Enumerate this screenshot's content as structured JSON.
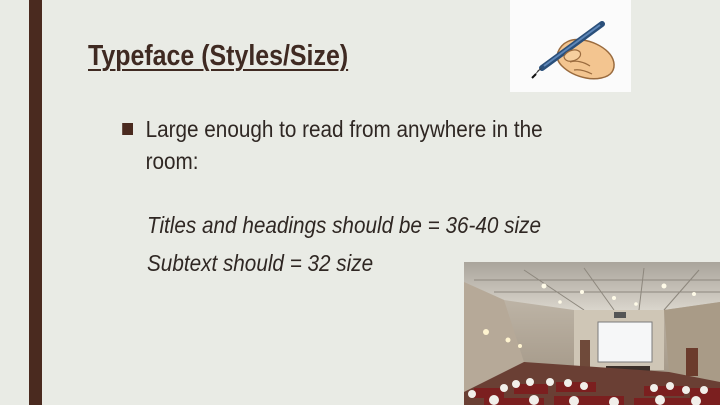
{
  "slide": {
    "title": "Typeface (Styles/Size)",
    "bullet": "Large enough to read from anywhere in the room:",
    "lines": [
      "Titles and headings should be = 36-40 size",
      "Subtext should = 32 size"
    ]
  },
  "colors": {
    "background": "#e9ebe5",
    "accent": "#4a2a1f",
    "title": "#3f2a22",
    "text": "#2f2723"
  },
  "icons": [
    "pen-writing-icon"
  ],
  "images": [
    "lecture-hall-photo"
  ]
}
